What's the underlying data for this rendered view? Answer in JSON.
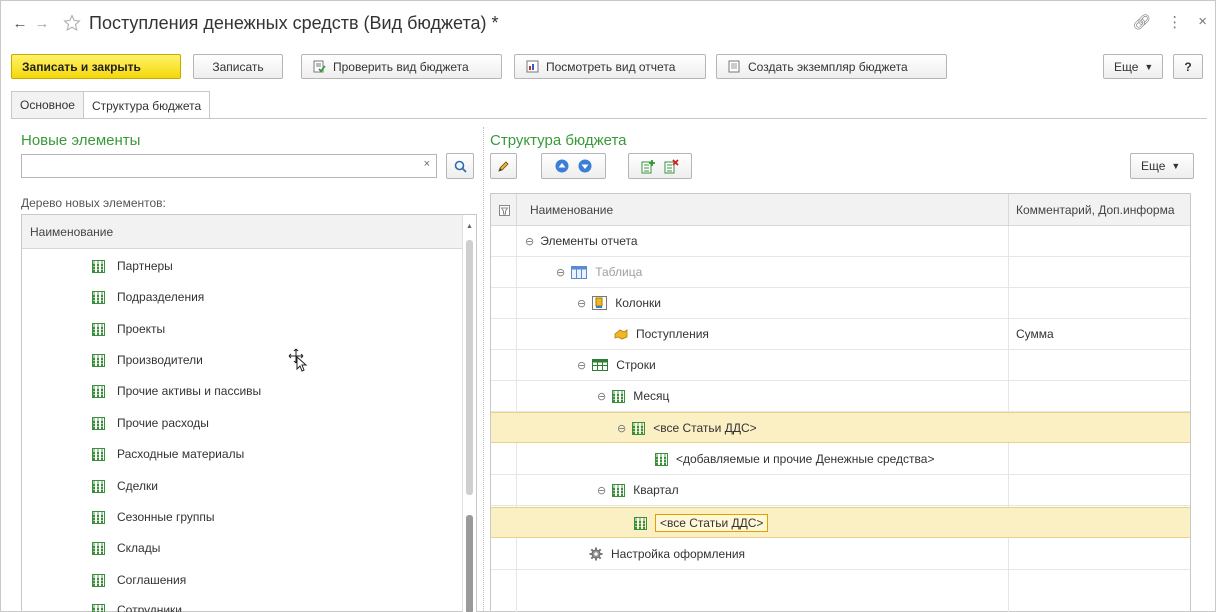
{
  "window": {
    "title": "Поступления денежных средств (Вид бюджета) *"
  },
  "toolbar": {
    "save_close": "Записать и закрыть",
    "save": "Записать",
    "check_view": "Проверить вид бюджета",
    "view_report": "Посмотреть вид отчета",
    "create_instance": "Создать экземпляр бюджета",
    "more": "Еще",
    "help": "?"
  },
  "tabs": [
    {
      "label": "Основное"
    },
    {
      "label": "Структура бюджета"
    }
  ],
  "left_pane": {
    "title": "Новые элементы",
    "search_value": "",
    "tree_label": "Дерево новых элементов:",
    "column_header": "Наименование",
    "items": [
      "Партнеры",
      "Подразделения",
      "Проекты",
      "Производители",
      "Прочие активы и пассивы",
      "Прочие расходы",
      "Расходные материалы",
      "Сделки",
      "Сезонные группы",
      "Склады",
      "Соглашения",
      "Сотрудники"
    ]
  },
  "right_pane": {
    "title": "Структура бюджета",
    "more": "Еще",
    "columns": {
      "name": "Наименование",
      "comment": "Комментарий, Доп.информа"
    },
    "rows": [
      {
        "name": "Элементы отчета",
        "comment": ""
      },
      {
        "name": "Таблица",
        "comment": ""
      },
      {
        "name": "Колонки",
        "comment": ""
      },
      {
        "name": "Поступления",
        "comment": "Сумма"
      },
      {
        "name": "Строки",
        "comment": ""
      },
      {
        "name": "Месяц",
        "comment": ""
      },
      {
        "name": "<все Статьи ДДС>",
        "comment": ""
      },
      {
        "name": "<добавляемые и прочие Денежные средства>",
        "comment": ""
      },
      {
        "name": "Квартал",
        "comment": ""
      },
      {
        "name": "<все Статьи ДДС>",
        "comment": ""
      },
      {
        "name": "Настройка оформления",
        "comment": ""
      }
    ]
  },
  "colors": {
    "accent_green": "#3a9a3a",
    "primary_button": "#f5d80a",
    "selection": "#fbefc4"
  }
}
